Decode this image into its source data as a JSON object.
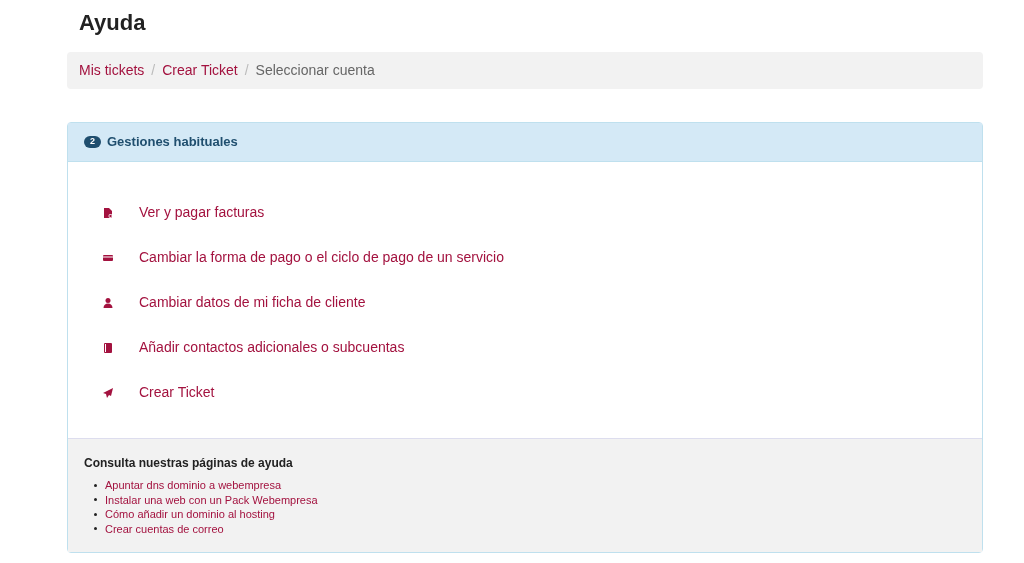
{
  "title": "Ayuda",
  "breadcrumb": [
    {
      "label": "Mis tickets",
      "kind": "link"
    },
    {
      "label": "Crear Ticket",
      "kind": "link",
      "separator": "/"
    },
    {
      "label": "Seleccionar cuenta",
      "kind": "current",
      "separator": "/"
    }
  ],
  "panel": {
    "step": "2",
    "title": "Gestiones habituales",
    "actions": [
      {
        "label": "Ver y pagar facturas",
        "kind": "invoice"
      },
      {
        "label": "Cambiar la forma de pago o el ciclo de pago de un servicio",
        "kind": "card"
      },
      {
        "label": "Cambiar datos de mi ficha de cliente",
        "kind": "user"
      },
      {
        "label": "Añadir contactos adicionales o subcuentas",
        "kind": "book"
      },
      {
        "label": "Crear Ticket",
        "kind": "send"
      }
    ],
    "help": {
      "heading": "Consulta nuestras páginas de ayuda",
      "links": [
        "Apuntar dns dominio a webempresa",
        "Instalar una web con un Pack Webempresa",
        "Cómo añadir un dominio al hosting",
        "Crear cuentas de correo"
      ]
    }
  }
}
